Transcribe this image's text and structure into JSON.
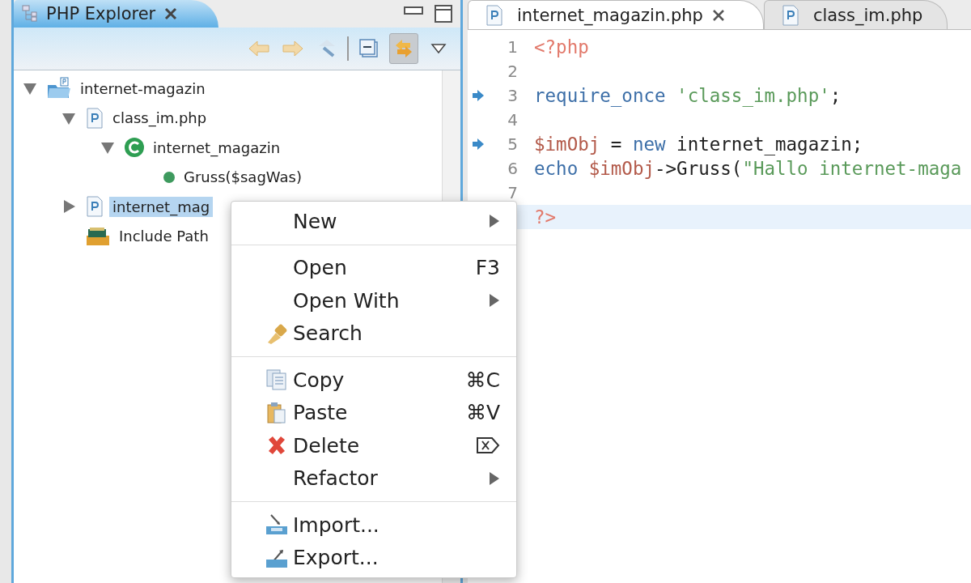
{
  "explorer": {
    "title": "PHP Explorer",
    "tree": [
      {
        "label": "internet-magazin",
        "kind": "project",
        "expanded": true,
        "selected": false,
        "children": [
          {
            "label": "class_im.php",
            "kind": "file",
            "expanded": true,
            "selected": false,
            "children": [
              {
                "label": "internet_magazin",
                "kind": "class",
                "expanded": true,
                "selected": false,
                "children": [
                  {
                    "label": "Gruss($sagWas)",
                    "kind": "method",
                    "selected": false
                  }
                ]
              }
            ]
          },
          {
            "label": "internet_mag",
            "kind": "file",
            "expanded": false,
            "selected": true
          },
          {
            "label": "Include Path",
            "kind": "library",
            "selected": false
          }
        ]
      }
    ]
  },
  "editor": {
    "tabs": [
      {
        "label": "internet_magazin.php",
        "selected": true,
        "closable": true
      },
      {
        "label": "class_im.php",
        "selected": false,
        "closable": false
      }
    ],
    "lines": [
      {
        "number": "1",
        "marked": false,
        "current": false,
        "tokens": [
          {
            "text": "<?php",
            "kind": "tag"
          }
        ]
      },
      {
        "number": "2",
        "marked": false,
        "current": false
      },
      {
        "number": "3",
        "marked": true,
        "current": false,
        "tokens": [
          {
            "text": "require_once",
            "kind": "keyword"
          },
          {
            "text": " 'class_im.php'",
            "kind": "string"
          },
          {
            "text": ";",
            "kind": "plain"
          }
        ]
      },
      {
        "number": "4",
        "marked": false,
        "current": false
      },
      {
        "number": "5",
        "marked": true,
        "current": false,
        "tokens": [
          {
            "text": "$imObj",
            "kind": "variable"
          },
          {
            "text": " = ",
            "kind": "plain"
          },
          {
            "text": "new",
            "kind": "keyword"
          },
          {
            "text": " internet_magazin;",
            "kind": "plain"
          }
        ]
      },
      {
        "number": "6",
        "marked": false,
        "current": false,
        "tokens": [
          {
            "text": "echo",
            "kind": "keyword"
          },
          {
            "text": " $imObj",
            "kind": "variable"
          },
          {
            "text": "->Gruss(",
            "kind": "plain"
          },
          {
            "text": "\"Hallo internet-maga",
            "kind": "string"
          }
        ]
      },
      {
        "number": "7",
        "marked": false,
        "current": false
      },
      {
        "marked": false,
        "current": true,
        "tokens": [
          {
            "text": "?>",
            "kind": "tag"
          }
        ]
      }
    ]
  },
  "context_menu": {
    "groups": [
      [
        {
          "label": "New",
          "kind": "plain",
          "submenu": true
        }
      ],
      [
        {
          "label": "Open",
          "kind": "plain",
          "shortcut": "F3",
          "submenu": false
        },
        {
          "label": "Open With",
          "kind": "plain",
          "submenu": true
        },
        {
          "label": "Search",
          "kind": "search",
          "submenu": false
        }
      ],
      [
        {
          "label": "Copy",
          "kind": "copy",
          "shortcut": "⌘C",
          "submenu": false
        },
        {
          "label": "Paste",
          "kind": "paste",
          "shortcut": "⌘V",
          "submenu": false
        },
        {
          "label": "Delete",
          "kind": "delete",
          "shortcut_icon": true,
          "submenu": false
        },
        {
          "label": "Refactor",
          "kind": "plain",
          "submenu": true
        }
      ],
      [
        {
          "label": "Import...",
          "kind": "import",
          "submenu": false
        },
        {
          "label": "Export...",
          "kind": "export",
          "submenu": false
        }
      ]
    ]
  }
}
